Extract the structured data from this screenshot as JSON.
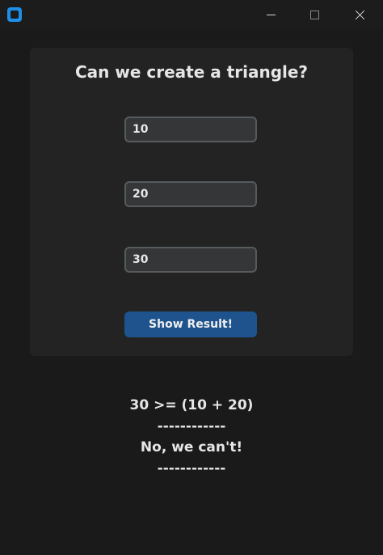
{
  "window": {
    "icon": "app-logo-icon",
    "controls": [
      "minimize-icon",
      "maximize-icon",
      "close-icon"
    ]
  },
  "form": {
    "title": "Can we create a triangle?",
    "side_a": "10",
    "side_b": "20",
    "side_c": "30",
    "button_label": "Show Result!"
  },
  "result": {
    "comparison": "30 >= (10 + 20)",
    "separator_top": "------------",
    "answer": "No, we can't!",
    "separator_bottom": "------------"
  }
}
